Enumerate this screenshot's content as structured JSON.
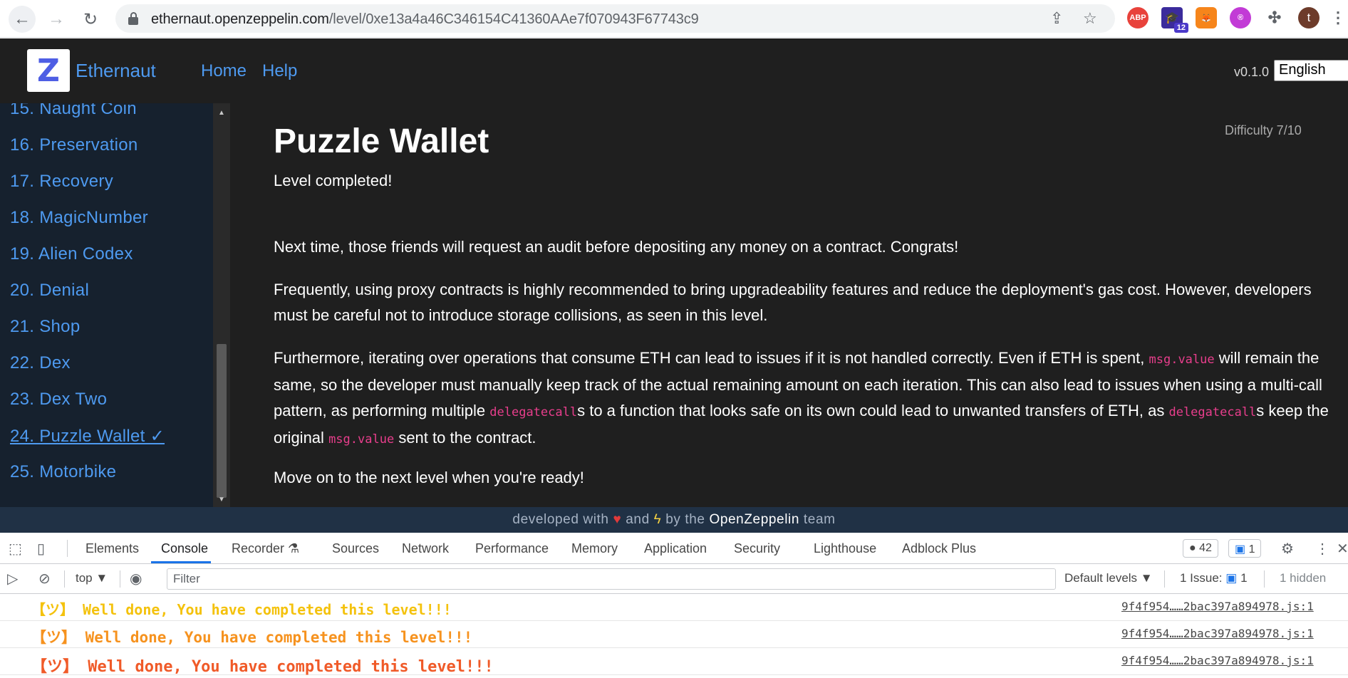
{
  "browser": {
    "url_host": "ethernaut.openzeppelin.com",
    "url_path": "/level/0xe13a4a46C346154C41360AAe7f070943F67743c9",
    "ext_abp": "ABP",
    "ext_count": "12",
    "ext_avatar": "t"
  },
  "header": {
    "logo_letter": "Z",
    "brand": "Ethernaut",
    "nav_home": "Home",
    "nav_help": "Help",
    "version": "v0.1.0",
    "language": "English"
  },
  "sidebar": {
    "items": [
      {
        "label": "15. Naught Coin"
      },
      {
        "label": "16. Preservation"
      },
      {
        "label": "17. Recovery"
      },
      {
        "label": "18. MagicNumber"
      },
      {
        "label": "19. Alien Codex"
      },
      {
        "label": "20. Denial"
      },
      {
        "label": "21. Shop"
      },
      {
        "label": "22. Dex"
      },
      {
        "label": "23. Dex Two"
      },
      {
        "label": "24. Puzzle Wallet ✓"
      },
      {
        "label": "25. Motorbike"
      }
    ],
    "active_index": 9
  },
  "main": {
    "title": "Puzzle Wallet",
    "difficulty": "Difficulty 7/10",
    "status": "Level completed!",
    "p1": "Next time, those friends will request an audit before depositing any money on a contract. Congrats!",
    "p2": "Frequently, using proxy contracts is highly recommended to bring upgradeability features and reduce the deployment's gas cost. However, developers must be careful not to introduce storage collisions, as seen in this level.",
    "p3_a": "Furthermore, iterating over operations that consume ETH can lead to issues if it is not handled correctly. Even if ETH is spent,",
    "p3_code1": "msg.value",
    "p3_b": "will remain the same, so the developer must manually keep track of the actual remaining amount on each iteration. This can also lead to issues when using a multi-call pattern, as performing multiple",
    "p3_code2": "delegatecall",
    "p3_c": "s to a function that looks safe on its own could lead to unwanted transfers of ETH, as",
    "p3_code3": "delegatecall",
    "p3_d": "s keep the original",
    "p3_code4": "msg.value",
    "p3_e": "sent to the contract.",
    "p4": "Move on to the next level when you're ready!"
  },
  "footer": {
    "prefix": "developed with",
    "and": "and",
    "by_the": "by the",
    "org": "OpenZeppelin",
    "suffix": "team"
  },
  "devtools": {
    "tabs": [
      "Elements",
      "Console",
      "Recorder",
      "Sources",
      "Network",
      "Performance",
      "Memory",
      "Application",
      "Security",
      "Lighthouse",
      "Adblock Plus"
    ],
    "active_tab": "Console",
    "errors_count": "42",
    "messages_count": "1",
    "context": "top",
    "filter_placeholder": "Filter",
    "levels": "Default levels",
    "issues_label": "1 Issue:",
    "issues_count": "1",
    "hidden": "1 hidden",
    "console_lines": [
      {
        "text": "【ツ】  Well done, You have completed this level!!!",
        "source": "9f4f954……2bac397a894978.js:1",
        "color": "#f4c20d"
      },
      {
        "text": "【ツ】  Well done, You have completed this level!!!",
        "source": "9f4f954……2bac397a894978.js:1",
        "color": "#f6921e"
      },
      {
        "text": "【ツ】  Well done, You have completed this level!!!",
        "source": "9f4f954……2bac397a894978.js:1",
        "color": "#f05a28"
      }
    ]
  },
  "colors": {
    "link_blue": "#4e9af0",
    "sidebar_bg": "#16212e",
    "content_bg": "#1f1f1f",
    "code_pink": "#e83e8c",
    "devtools_accent": "#1a73e8"
  }
}
